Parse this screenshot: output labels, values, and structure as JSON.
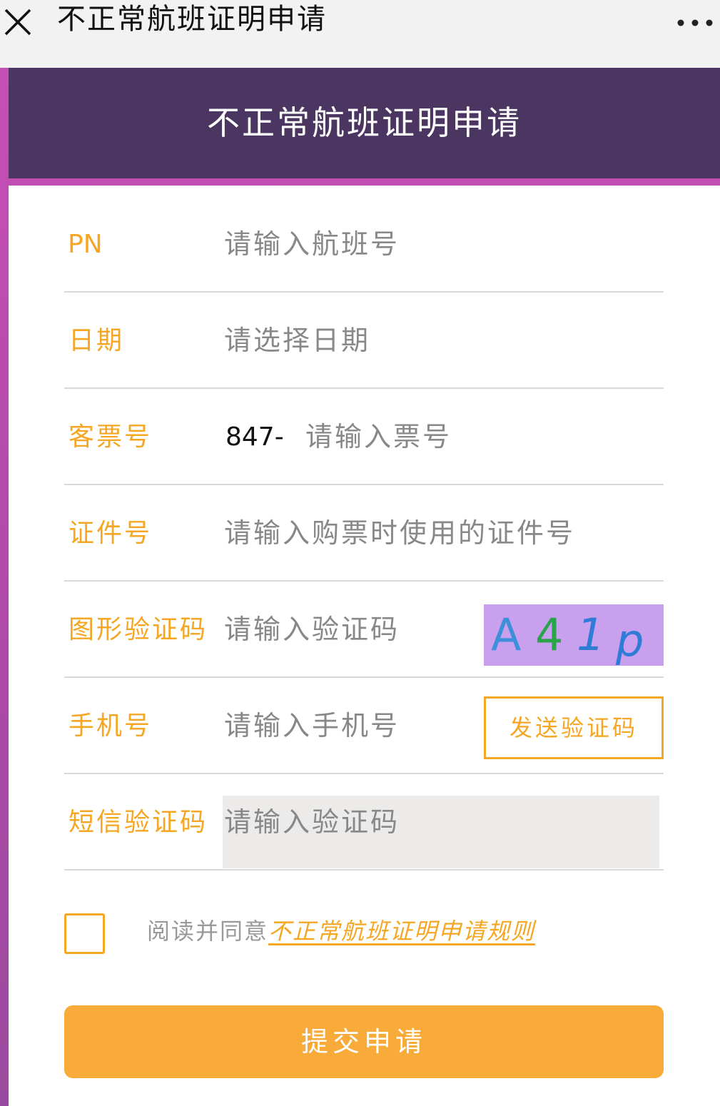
{
  "window": {
    "title": "不正常航班证明申请",
    "close_icon": "close-icon",
    "more_icon": "more-icon"
  },
  "header": {
    "title": "不正常航班证明申请"
  },
  "form": {
    "flight": {
      "label": "PN",
      "placeholder": "请输入航班号"
    },
    "date": {
      "label": "日期",
      "placeholder": "请选择日期"
    },
    "ticket": {
      "label": "客票号",
      "prefix": "847-",
      "placeholder": "请输入票号"
    },
    "id_number": {
      "label": "证件号",
      "placeholder": "请输入购票时使用的证件号"
    },
    "captcha": {
      "label": "图形验证码",
      "placeholder": "请输入验证码",
      "image_text": "A41p"
    },
    "phone": {
      "label": "手机号",
      "placeholder": "请输入手机号",
      "send_button": "发送验证码"
    },
    "sms": {
      "label": "短信验证码",
      "placeholder": "请输入验证码"
    }
  },
  "agreement": {
    "prefix": "阅读并同意",
    "link": "不正常航班证明申请规则"
  },
  "submit": {
    "label": "提交申请"
  },
  "colors": {
    "accent": "#f5a623",
    "header_bg": "#4a3660",
    "frame": "#c64fb8",
    "captcha_bg": "#c8a0ee"
  }
}
